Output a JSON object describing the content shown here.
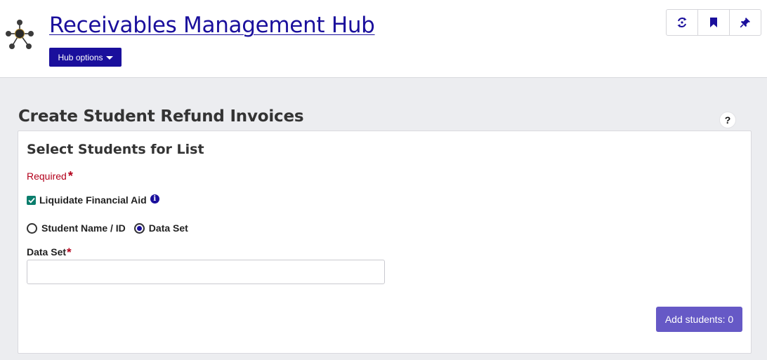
{
  "header": {
    "logo_icon": "hub-network-icon",
    "title": "Receivables Management Hub",
    "options_label": "Hub options",
    "toolbar": [
      {
        "name": "sync-icon"
      },
      {
        "name": "bookmark-icon"
      },
      {
        "name": "pin-icon"
      }
    ]
  },
  "page": {
    "title": "Create Student Refund Invoices",
    "help_label": "?"
  },
  "card": {
    "title": "Select Students for List",
    "required_label": "Required",
    "required_star": "*",
    "liquidate_label": "Liquidate Financial Aid",
    "liquidate_checked": true,
    "info_icon": "i",
    "radio_options": [
      {
        "label": "Student Name / ID",
        "selected": false
      },
      {
        "label": "Data Set",
        "selected": true
      }
    ],
    "dataset_label": "Data Set",
    "dataset_value": "",
    "add_button_label": "Add students: 0"
  },
  "colors": {
    "brand": "#1a0f9c",
    "accent_button": "#6659c6",
    "required": "#b3001b",
    "checkbox": "#0a7d6c"
  }
}
